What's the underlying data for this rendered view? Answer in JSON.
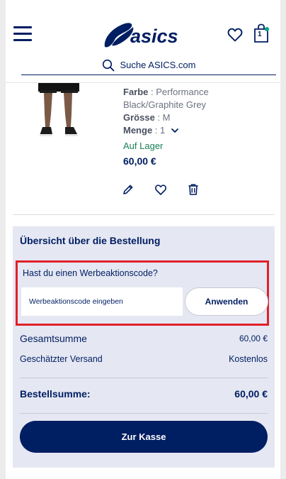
{
  "header": {
    "search": {
      "placeholder": "Suche ASICS.com"
    },
    "bag_count": "1"
  },
  "product": {
    "color_label": "Farbe",
    "color_value": "Performance Black/Graphite Grey",
    "size_label": "Grösse",
    "size_value": "M",
    "qty_label": "Menge",
    "qty_value": "1",
    "stock": "Auf Lager",
    "price": "60,00 €"
  },
  "summary": {
    "title": "Übersicht über die Bestellung",
    "promo_question": "Hast du einen Werbeaktionscode?",
    "promo_placeholder": "Werbeaktionscode eingeben",
    "promo_button": "Anwenden",
    "subtotal_label": "Gesamtsumme",
    "subtotal_value": "60,00 €",
    "shipping_label": "Geschätzter Versand",
    "shipping_value": "Kostenlos",
    "order_total_label": "Bestellsumme:",
    "order_total_value": "60,00 €",
    "checkout_button": "Zur Kasse"
  },
  "colors": {
    "brand_navy": "#001e62",
    "summary_bg": "#e5e7f2",
    "highlight_red": "#e0202a",
    "stock_green": "#1b7f58"
  }
}
